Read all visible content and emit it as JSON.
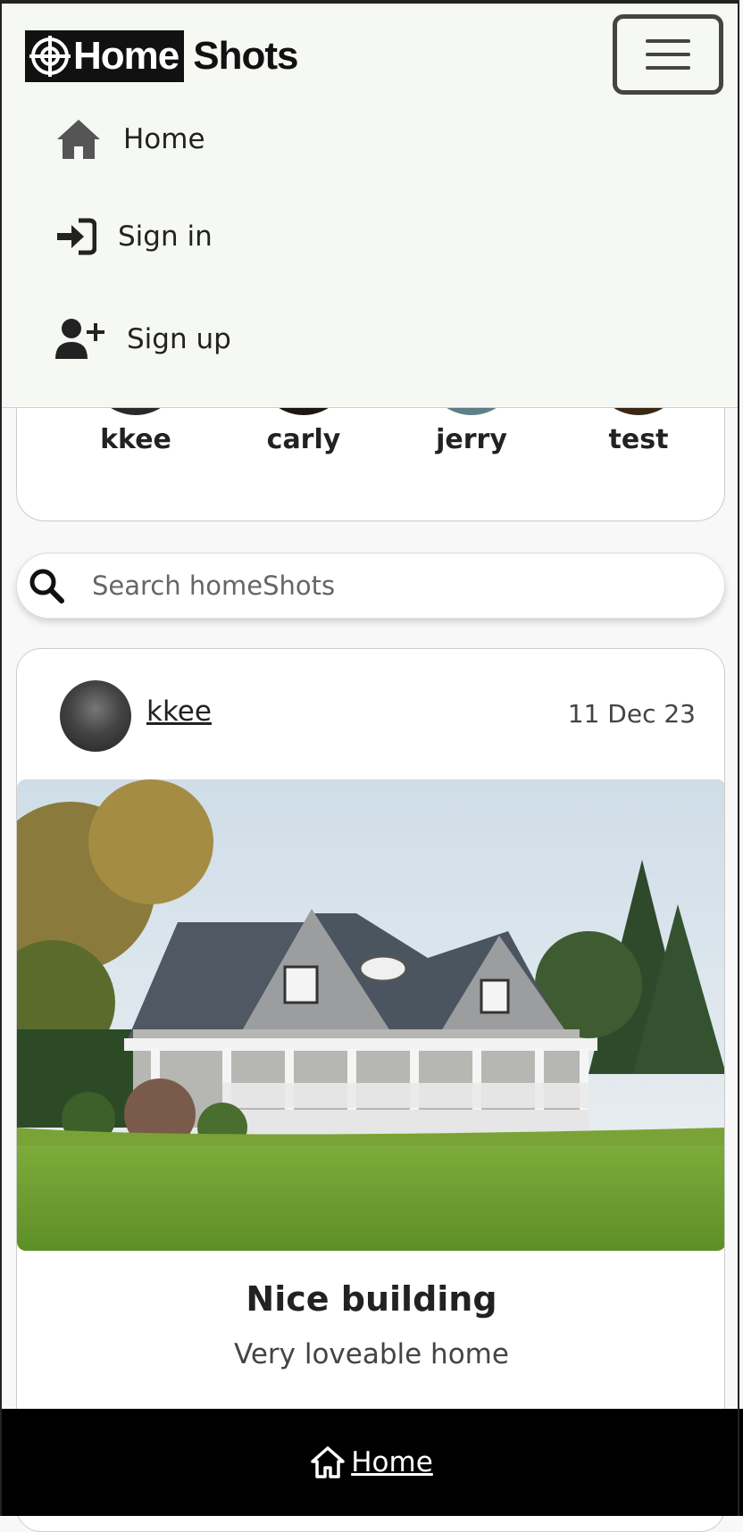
{
  "brand": {
    "part1": "Home",
    "part2": "Shots"
  },
  "nav": {
    "items": [
      {
        "label": "Home",
        "icon": "home-icon"
      },
      {
        "label": "Sign in",
        "icon": "sign-in-icon"
      },
      {
        "label": "Sign up",
        "icon": "user-plus-icon"
      }
    ]
  },
  "profiles": [
    {
      "name": "kkee"
    },
    {
      "name": "carly"
    },
    {
      "name": "jerry"
    },
    {
      "name": "test"
    }
  ],
  "search": {
    "placeholder": "Search homeShots",
    "icon": "search-icon"
  },
  "post": {
    "user": "kkee",
    "date": "11 Dec 23",
    "title": "Nice building",
    "description": "Very loveable home"
  },
  "footer": {
    "link_label": "Home",
    "icon": "home-outline-icon"
  },
  "colors": {
    "header_bg": "#f6f8f4",
    "footer_bg": "#000000",
    "text": "#222222"
  }
}
